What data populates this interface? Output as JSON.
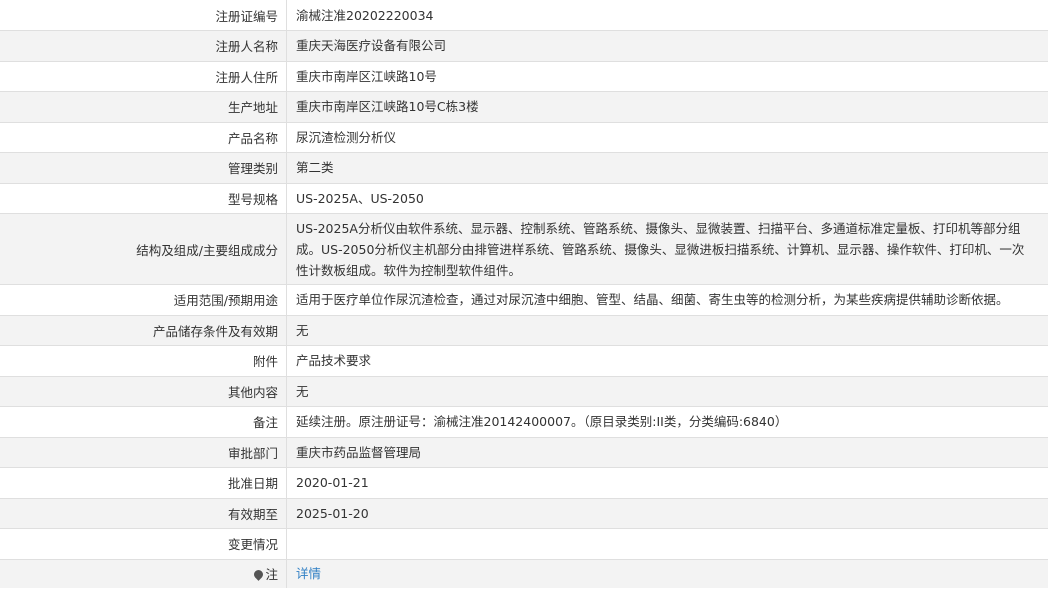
{
  "rows": [
    {
      "label": "注册证编号",
      "value": "渝械注准20202220034"
    },
    {
      "label": "注册人名称",
      "value": "重庆天海医疗设备有限公司"
    },
    {
      "label": "注册人住所",
      "value": "重庆市南岸区江峡路10号"
    },
    {
      "label": "生产地址",
      "value": "重庆市南岸区江峡路10号C栋3楼"
    },
    {
      "label": "产品名称",
      "value": "尿沉渣检测分析仪"
    },
    {
      "label": "管理类别",
      "value": "第二类"
    },
    {
      "label": "型号规格",
      "value": "US-2025A、US-2050"
    },
    {
      "label": "结构及组成/主要组成成分",
      "value": "US-2025A分析仪由软件系统、显示器、控制系统、管路系统、摄像头、显微装置、扫描平台、多通道标准定量板、打印机等部分组成。US-2050分析仪主机部分由排管进样系统、管路系统、摄像头、显微进板扫描系统、计算机、显示器、操作软件、打印机、一次性计数板组成。软件为控制型软件组件。"
    },
    {
      "label": "适用范围/预期用途",
      "value": "适用于医疗单位作尿沉渣检查，通过对尿沉渣中细胞、管型、结晶、细菌、寄生虫等的检测分析，为某些疾病提供辅助诊断依据。"
    },
    {
      "label": "产品储存条件及有效期",
      "value": "无"
    },
    {
      "label": "附件",
      "value": "产品技术要求"
    },
    {
      "label": "其他内容",
      "value": "无"
    },
    {
      "label": "备注",
      "value": "延续注册。原注册证号：渝械注准20142400007。（原目录类别:II类，分类编码:6840）"
    },
    {
      "label": "审批部门",
      "value": "重庆市药品监督管理局"
    },
    {
      "label": "批准日期",
      "value": "2020-01-21"
    },
    {
      "label": "有效期至",
      "value": "2025-01-20"
    },
    {
      "label": "变更情况",
      "value": ""
    }
  ],
  "note": {
    "label": "注",
    "link_text": "详情",
    "icon": "pin-icon"
  }
}
